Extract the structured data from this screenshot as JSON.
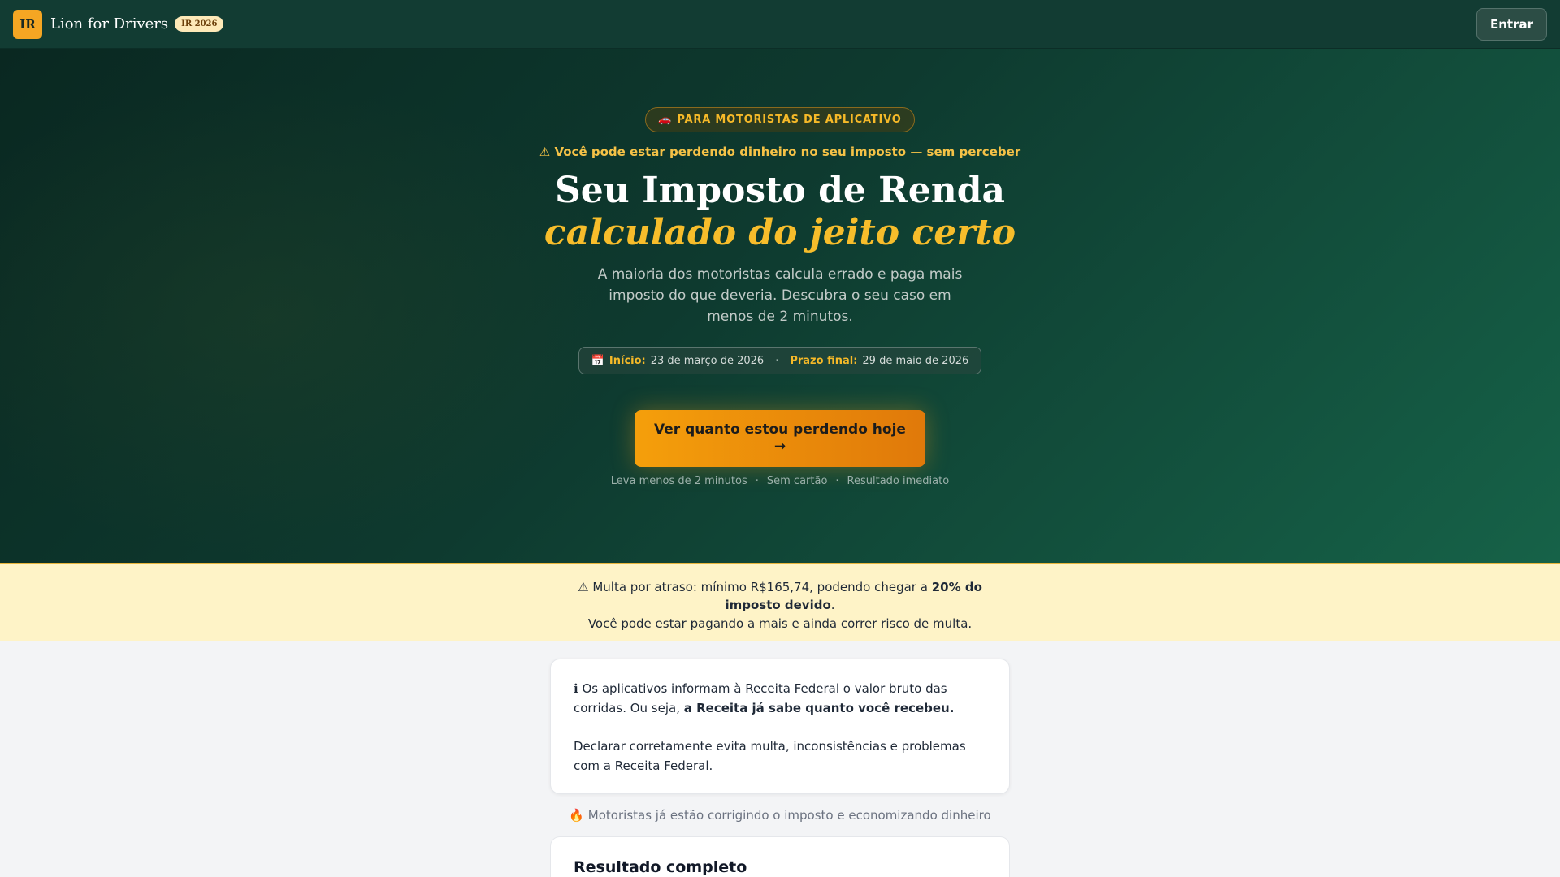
{
  "navbar": {
    "logo_text": "IR",
    "brand": "Lion for Drivers",
    "year_badge": "IR 2026",
    "login_label": "Entrar"
  },
  "hero": {
    "pill_icon": "car-icon",
    "pill_emoji": "🚗",
    "pill_text": "PARA MOTORISTAS DE APLICATIVO",
    "warning": "⚠ Você pode estar perdendo dinheiro no seu imposto — sem perceber",
    "title_line1": "Seu Imposto de Renda",
    "title_line2": "calculado do jeito certo",
    "subtitle": "A maioria dos motoristas calcula errado e paga mais imposto do que deveria. Descubra o seu caso em menos de 2 minutos.",
    "dates": {
      "calendar_emoji": "📅",
      "start_label": "Início:",
      "start_value": "23 de março de 2026",
      "separator": "·",
      "end_label": "Prazo final:",
      "end_value": "29 de maio de 2026"
    },
    "cta_line1": "Ver quanto estou perdendo hoje",
    "cta_line2": "→",
    "cta_notes": [
      "Leva menos de 2 minutos",
      "·",
      "Sem cartão",
      "·",
      "Resultado imediato"
    ]
  },
  "banner": {
    "prefix": "⚠ Multa por atraso: mínimo R$165,74, podendo chegar a ",
    "bold": "20% do imposto devido",
    "suffix": ".",
    "line2": "Você pode estar pagando a mais e ainda correr risco de multa."
  },
  "info_card": {
    "icon": "info-icon",
    "p1_prefix": "ℹ Os aplicativos informam à Receita Federal o valor bruto das corridas. Ou seja, ",
    "p1_bold": "a Receita já sabe quanto você recebeu.",
    "p2": "Declarar corretamente evita multa, inconsistências e problemas com a Receita Federal."
  },
  "social_proof": "🔥 Motoristas já estão corrigindo o imposto e economizando dinheiro",
  "result_card": {
    "title": "Resultado completo"
  },
  "colors": {
    "accent": "#f59f0b",
    "hero_dark": "#0a2821",
    "hero_light": "#166248",
    "banner_bg": "#fef3c7"
  }
}
